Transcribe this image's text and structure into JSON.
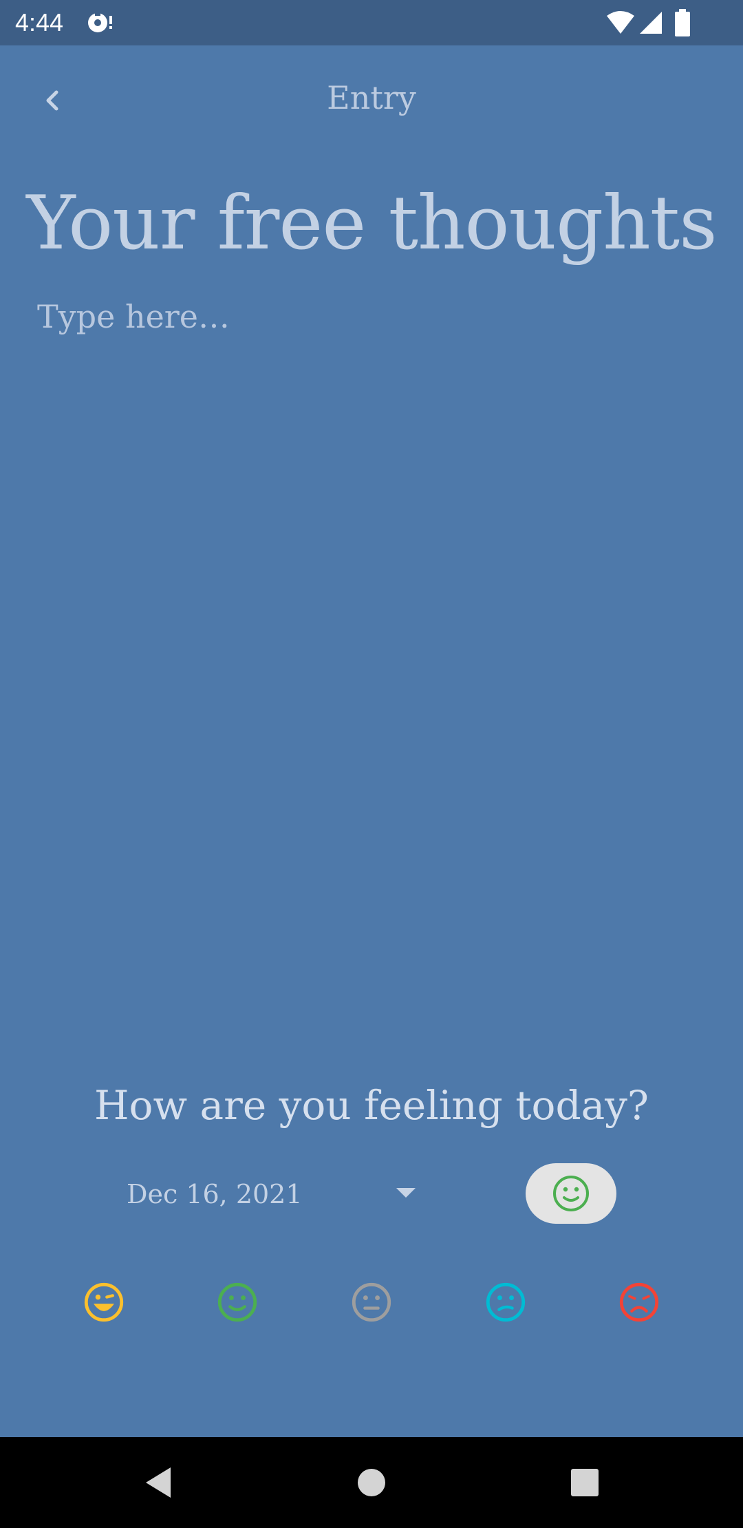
{
  "status_bar": {
    "time": "4:44",
    "icons": [
      "notification-icon",
      "wifi-icon",
      "signal-icon",
      "battery-icon"
    ]
  },
  "app_bar": {
    "title": "Entry",
    "back_icon": "chevron-left-icon"
  },
  "heading": "Your free thoughts",
  "editor": {
    "value": "",
    "placeholder": "Type here…"
  },
  "mood_section": {
    "question": "How are you feeling today?",
    "date": "Dec 16, 2021",
    "selected_mood": "good",
    "moods": [
      {
        "name": "great",
        "icon": "laughing-face-icon",
        "color": "#fbc02d"
      },
      {
        "name": "good",
        "icon": "smiling-face-icon",
        "color": "#4caf50"
      },
      {
        "name": "neutral",
        "icon": "neutral-face-icon",
        "color": "#9e9e9e"
      },
      {
        "name": "bad",
        "icon": "confused-face-icon",
        "color": "#00bcd4"
      },
      {
        "name": "awful",
        "icon": "sad-face-icon",
        "color": "#f44336"
      }
    ]
  },
  "colors": {
    "background": "#4e79aa",
    "status_bar": "#3d5e86",
    "chip": "#e4e4e4",
    "text_light": "#c3d1e4"
  },
  "nav_bar": {
    "icons": [
      "back-triangle-icon",
      "home-circle-icon",
      "recents-square-icon"
    ]
  }
}
